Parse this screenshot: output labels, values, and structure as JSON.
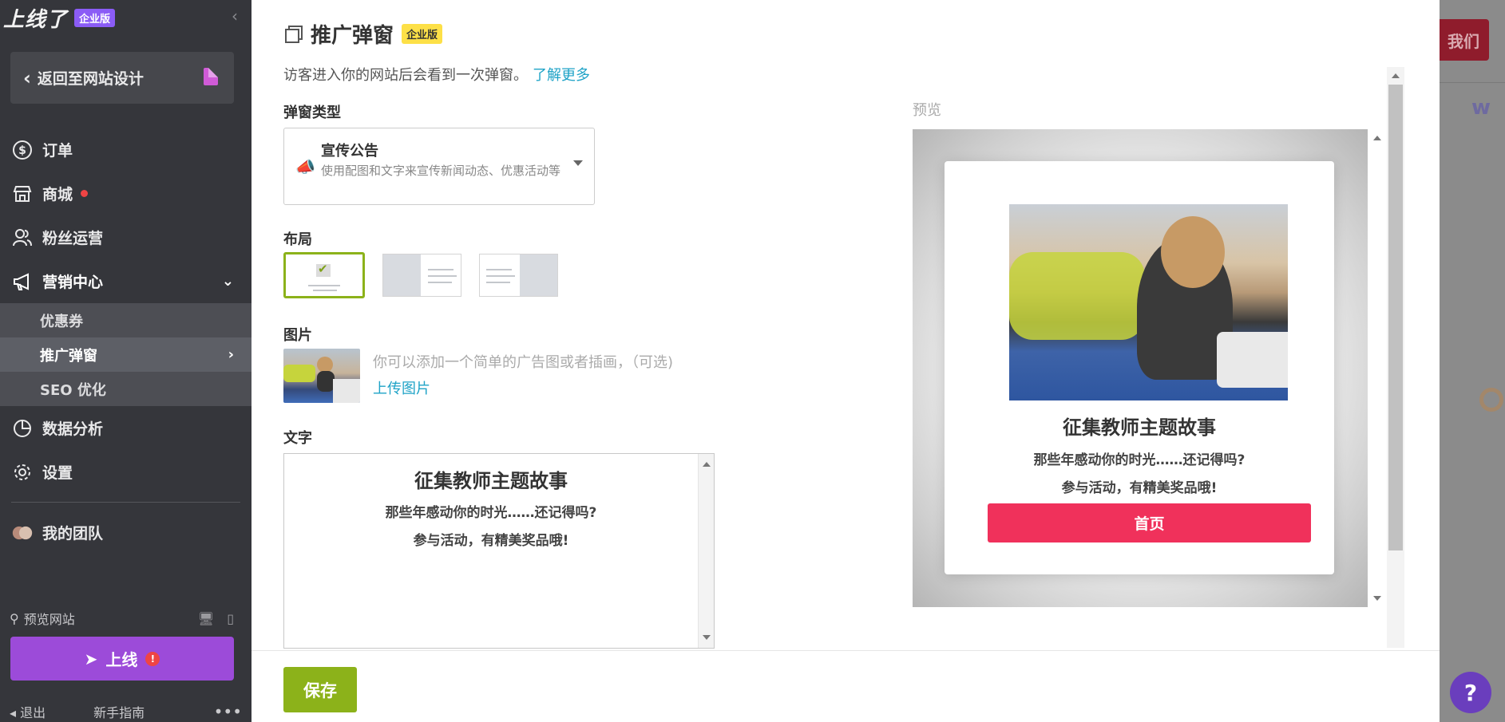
{
  "sidebar": {
    "brand": "上线了",
    "edition_badge": "企业版",
    "back_label": "返回至网站设计",
    "items": [
      {
        "label": "订单",
        "icon": "dollar-circle-icon"
      },
      {
        "label": "商城",
        "icon": "store-icon"
      },
      {
        "label": "粉丝运营",
        "icon": "users-icon"
      },
      {
        "label": "营销中心",
        "icon": "megaphone-icon"
      }
    ],
    "subitems": [
      {
        "label": "优惠券"
      },
      {
        "label": "推广弹窗"
      },
      {
        "label": "SEO 优化"
      }
    ],
    "items2": [
      {
        "label": "数据分析",
        "icon": "pie-chart-icon"
      },
      {
        "label": "设置",
        "icon": "gear-icon"
      },
      {
        "label": "我的团队",
        "icon": "team-avatar-icon"
      }
    ],
    "preview_site": "预览网站",
    "launch_label": "上线",
    "launch_alert": "!",
    "logout": "退出",
    "guide": "新手指南",
    "more": "•••"
  },
  "main": {
    "title": "推广弹窗",
    "badge": "企业版",
    "intro": "访客进入你的网站后会看到一次弹窗。",
    "learn_more": "了解更多",
    "popup_type_label": "弹窗类型",
    "popup_type": {
      "name": "宣传公告",
      "desc": "使用配图和文字来宣传新闻动态、优惠活动等"
    },
    "layout_label": "布局",
    "image_label": "图片",
    "image_hint": "你可以添加一个简单的广告图或者插画，（可选)",
    "upload_label": "上传图片",
    "text_label": "文字",
    "text": {
      "title": "征集教师主题故事",
      "line1": "那些年感动你的时光……还记得吗?",
      "line2": "参与活动，有精美奖品哦!"
    },
    "preview_label": "预览",
    "preview": {
      "title": "征集教师主题故事",
      "line1": "那些年感动你的时光……还记得吗?",
      "line2": "参与活动，有精美奖品哦!",
      "button": "首页"
    },
    "save_label": "保存"
  },
  "backdrop": {
    "button_partial": "我们",
    "help": "?"
  },
  "colors": {
    "sidebar_bg": "#35363b",
    "accent_green": "#8cb21a",
    "accent_purple": "#9c4bd9",
    "preview_button": "#f0315b",
    "link": "#1fa3c7",
    "badge_yellow": "#fde047"
  }
}
